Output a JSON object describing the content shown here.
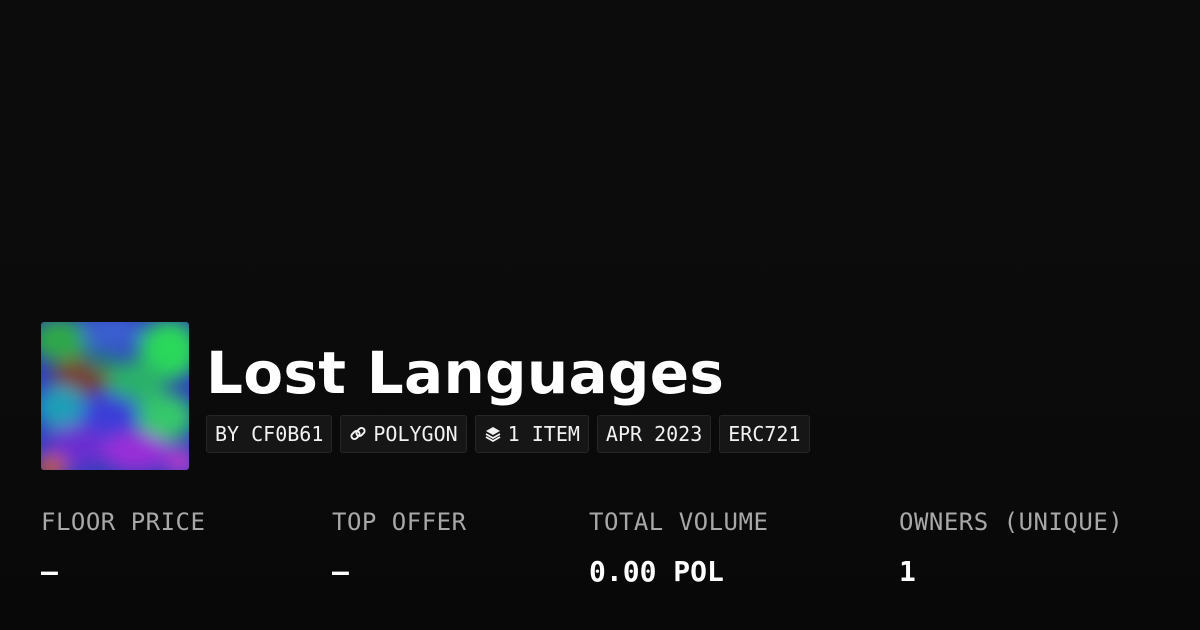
{
  "collection": {
    "title": "Lost Languages",
    "thumbnail_icon": "collection-artwork"
  },
  "tags": {
    "creator": "BY CF0B61",
    "chain": "POLYGON",
    "chain_icon": "link-icon",
    "items": "1 ITEM",
    "items_icon": "layers-icon",
    "date": "APR 2023",
    "standard": "ERC721"
  },
  "stats": {
    "floor_price": {
      "label": "FLOOR PRICE",
      "value": "–"
    },
    "top_offer": {
      "label": "TOP OFFER",
      "value": "–"
    },
    "total_volume": {
      "label": "TOTAL VOLUME",
      "value": "0.00 POL"
    },
    "owners": {
      "label": "OWNERS (UNIQUE)",
      "value": "1"
    }
  },
  "colors": {
    "background": "#0b0b0b",
    "text": "#ffffff",
    "muted": "#a8a8a8",
    "tag_bg": "#161616"
  }
}
